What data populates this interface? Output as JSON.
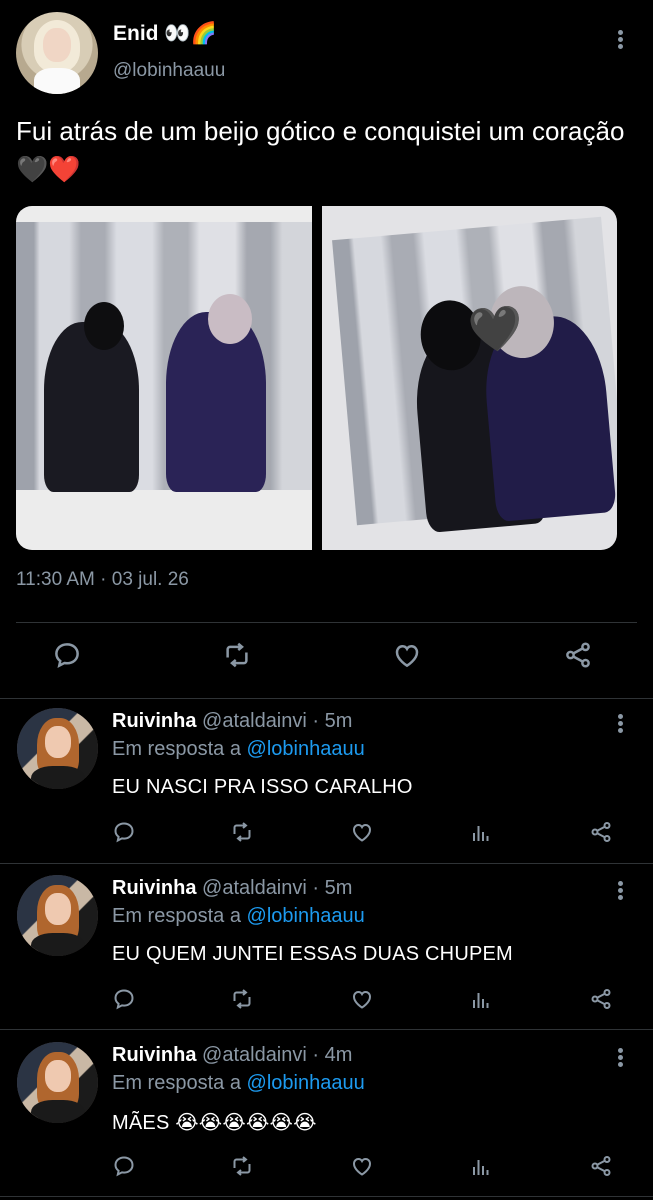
{
  "tweet": {
    "author_name": "Enid 👀🌈",
    "author_handle": "@lobinhaauu",
    "text": "Fui atrás de um beijo gótico e conquistei um coração 🖤❤️",
    "timestamp": "11:30 AM · 03 jul. 26",
    "heart_sticker": "🖤"
  },
  "replies": [
    {
      "name": "Ruivinha",
      "handle": "@ataldainvi",
      "time": "· 5m",
      "reply_prefix": "Em resposta a",
      "reply_to": "@lobinhaauu",
      "text": "EU NASCI PRA ISSO CARALHO"
    },
    {
      "name": "Ruivinha",
      "handle": "@ataldainvi",
      "time": "· 5m",
      "reply_prefix": "Em resposta a",
      "reply_to": "@lobinhaauu",
      "text": "EU QUEM JUNTEI ESSAS DUAS CHUPEM"
    },
    {
      "name": "Ruivinha",
      "handle": "@ataldainvi",
      "time": "· 4m",
      "reply_prefix": "Em resposta a",
      "reply_to": "@lobinhaauu",
      "text": "MÃES 😭😭😭😭😭😭"
    }
  ],
  "icons": {
    "reply": "reply-icon",
    "retweet": "retweet-icon",
    "like": "heart-icon",
    "views": "views-icon",
    "share": "share-icon",
    "more": "more-icon"
  },
  "colors": {
    "background": "#000000",
    "text": "#ffffff",
    "secondary": "#8b98a5",
    "link": "#1d9bf0",
    "divider": "#2f3336"
  }
}
